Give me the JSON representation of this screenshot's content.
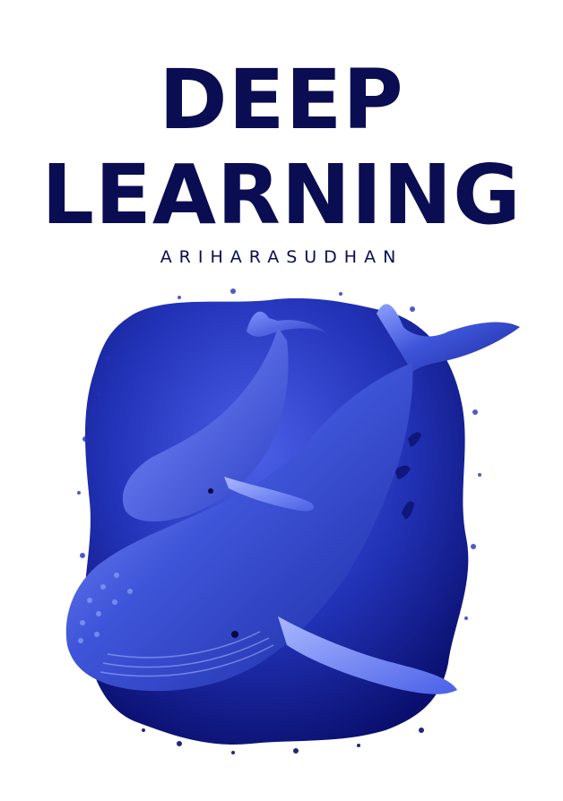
{
  "cover": {
    "title_line1": "DEEP",
    "title_line2": "LEARNING",
    "author": "ARIHARASUDHAN"
  },
  "colors": {
    "title": "#0b0d52",
    "background": "#ffffff",
    "ocean_light": "#4a5ee6",
    "ocean_dark": "#0a0f6e",
    "whale": "#3f55d9",
    "whale_highlight": "#8da0ff"
  },
  "illustration": {
    "subject": "humpback-whale-mother-and-calf-icon"
  }
}
